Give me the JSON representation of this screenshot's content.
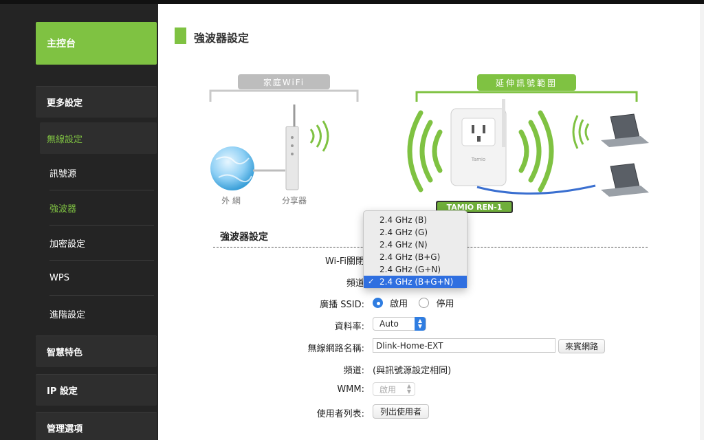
{
  "sidebar": {
    "dashboard": "主控台",
    "more_settings": "更多設定",
    "wireless_settings": "無線設定",
    "items": [
      {
        "label": "訊號源",
        "active": false
      },
      {
        "label": "強波器",
        "active": true
      },
      {
        "label": "加密設定",
        "active": false
      },
      {
        "label": "WPS",
        "active": false
      },
      {
        "label": "進階設定",
        "active": false
      }
    ],
    "smart_features": "智慧特色",
    "ip_settings": "IP 設定",
    "management": "管理選項"
  },
  "page": {
    "title": "強波器設定"
  },
  "illustration": {
    "home_wifi_label": "家庭WiFi",
    "extend_label": "延伸訊號範圍",
    "internet_label": "外 網",
    "router_label": "分享器",
    "product_label": "TAMIO REN-1",
    "device_brand": "Tamio"
  },
  "form": {
    "section_title": "強波器設定",
    "wifi_toggle_label": "Wi-Fi關閉",
    "band_label": "頻道",
    "ssid_broadcast_label": "廣播 SSID:",
    "ssid_on": "啟用",
    "ssid_off": "停用",
    "rate_label": "資料率:",
    "rate_value": "Auto",
    "network_name_label": "無線網路名稱:",
    "network_name_value": "Dlink-Home-EXT",
    "guest_button": "來賓網路",
    "channel_label": "頻道:",
    "channel_value": "(與訊號源設定相同)",
    "wmm_label": "WMM:",
    "wmm_value": "啟用",
    "user_list_label": "使用者列表:",
    "list_users_button": "列出使用者"
  },
  "dropdown": {
    "options": [
      "2.4 GHz (B)",
      "2.4 GHz (G)",
      "2.4 GHz (N)",
      "2.4 GHz (B+G)",
      "2.4 GHz (G+N)",
      "2.4 GHz (B+G+N)"
    ],
    "selected_index": 5,
    "check_mark": "✓"
  },
  "colors": {
    "accent_green": "#7fc242",
    "sidebar_bg": "#242424",
    "select_blue": "#2f6fe0"
  }
}
